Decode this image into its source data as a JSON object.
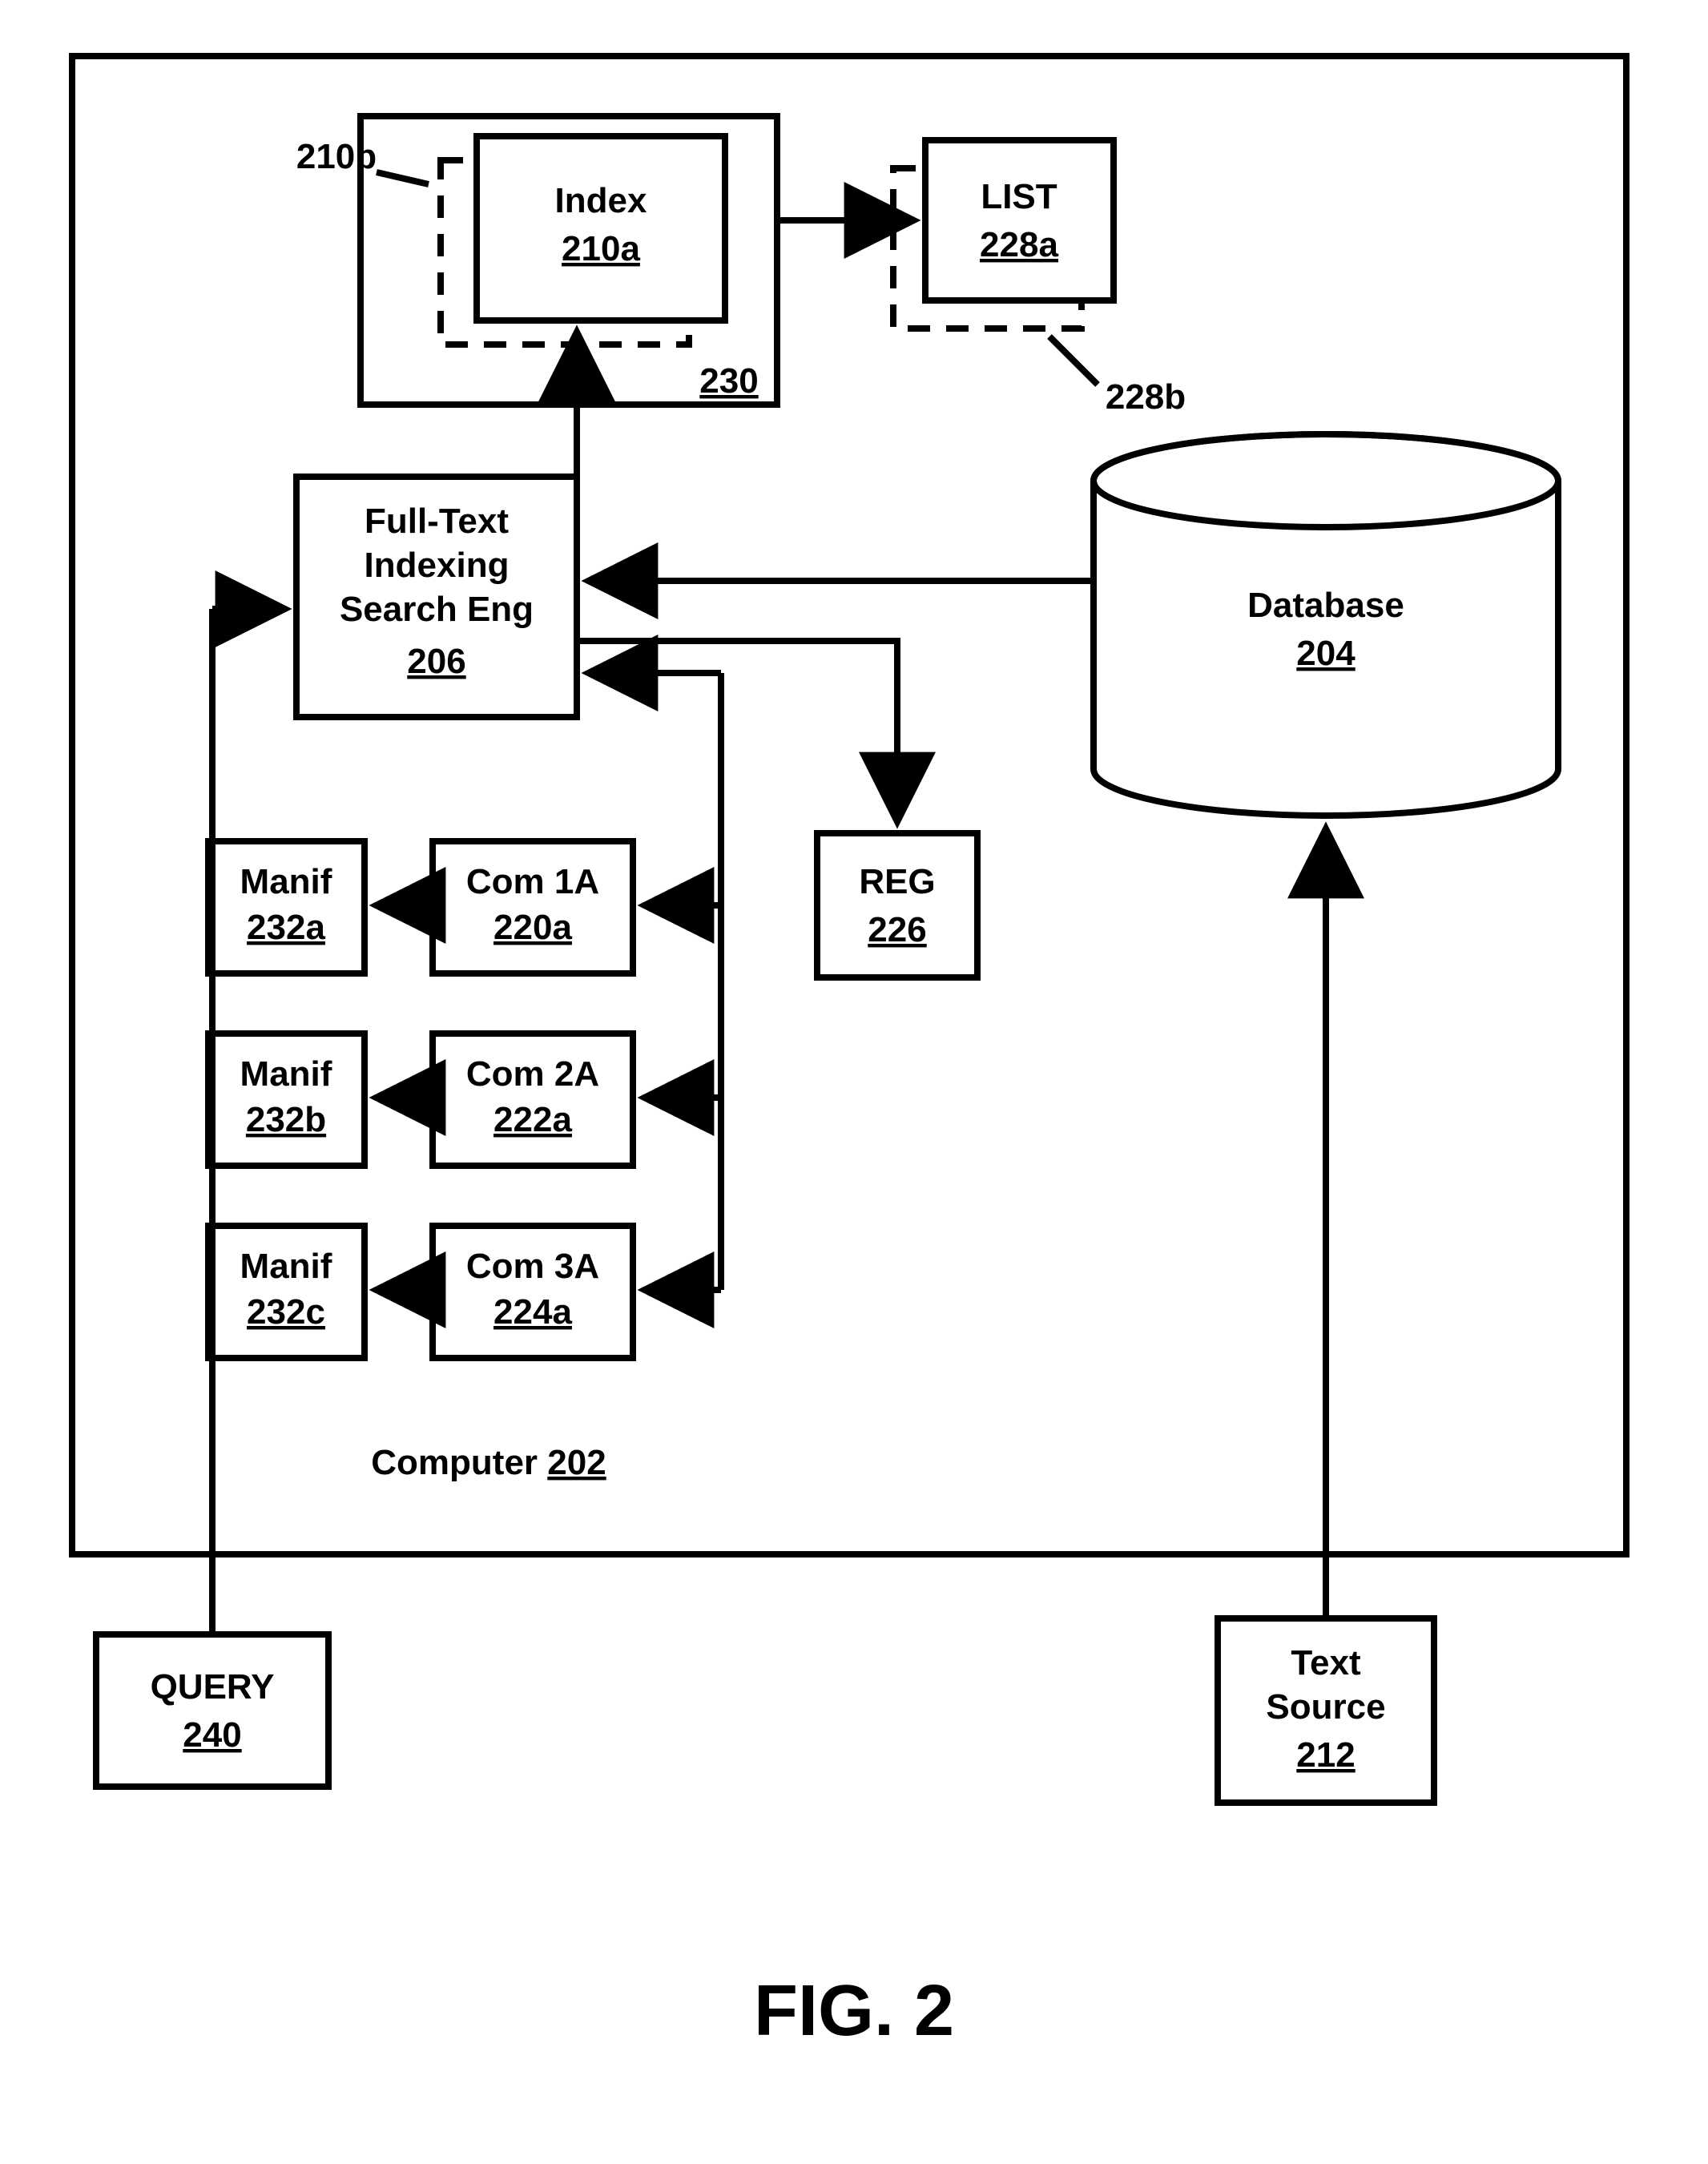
{
  "figure_label": "FIG. 2",
  "computer": {
    "label": "Computer",
    "ref": "202"
  },
  "index": {
    "label": "Index",
    "ref": "210a",
    "stack_ref": "210b",
    "group_ref": "230"
  },
  "list": {
    "label": "LIST",
    "ref": "228a",
    "stack_ref": "228b"
  },
  "engine": {
    "l1": "Full-Text",
    "l2": "Indexing",
    "l3": "Search Eng",
    "ref": "206"
  },
  "database": {
    "label": "Database",
    "ref": "204"
  },
  "reg": {
    "label": "REG",
    "ref": "226"
  },
  "manif": [
    {
      "label": "Manif",
      "ref": "232a"
    },
    {
      "label": "Manif",
      "ref": "232b"
    },
    {
      "label": "Manif",
      "ref": "232c"
    }
  ],
  "com": [
    {
      "label": "Com 1A",
      "ref": "220a"
    },
    {
      "label": "Com 2A",
      "ref": "222a"
    },
    {
      "label": "Com 3A",
      "ref": "224a"
    }
  ],
  "query": {
    "label": "QUERY",
    "ref": "240"
  },
  "text_source": {
    "l1": "Text",
    "l2": "Source",
    "ref": "212"
  }
}
